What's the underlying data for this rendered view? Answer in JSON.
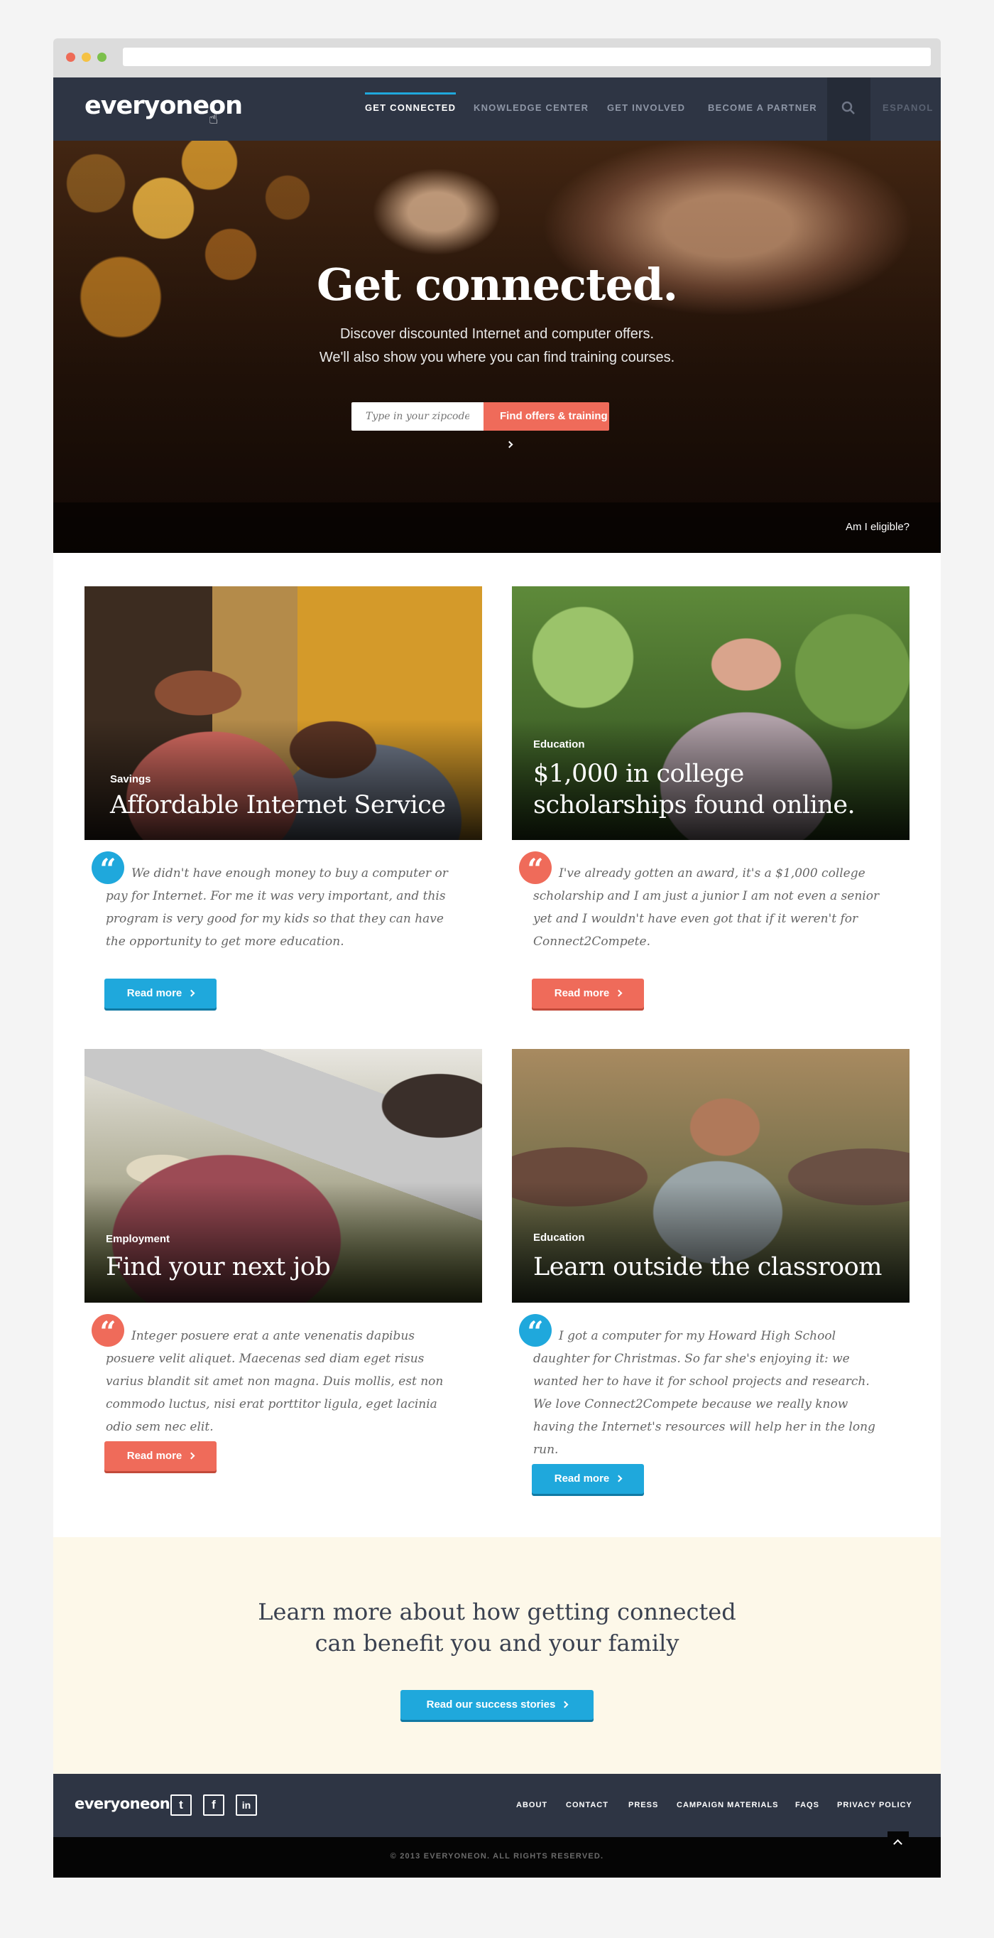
{
  "nav": {
    "logo": "everyoneon",
    "items": [
      {
        "label": "GET CONNECTED",
        "active": true
      },
      {
        "label": "KNOWLEDGE CENTER"
      },
      {
        "label": "GET INVOLVED"
      },
      {
        "label": "BECOME A PARTNER"
      }
    ],
    "lang": "ESPANOL"
  },
  "hero": {
    "title": "Get connected.",
    "sub1": "Discover discounted Internet and computer offers.",
    "sub2": "We'll also show you where you can find training courses.",
    "zip_placeholder": "Type in your zipcode",
    "button": "Find offers & training",
    "eligible": "Am I eligible?"
  },
  "cards": [
    {
      "category": "Savings",
      "title": "Affordable Internet Service",
      "quote": "We didn't have enough money to buy a computer or pay for Internet. For me it was very important, and this program is very good for my kids so that they can have the opportunity to get more education.",
      "button": "Read more",
      "accent": "blue"
    },
    {
      "category": "Education",
      "title": "$1,000 in college scholarships found online.",
      "quote": "I've already gotten an award, it's a $1,000 college scholarship and I am just a junior I am not even a senior yet and I wouldn't have even got that if it weren't for Connect2Compete.",
      "button": "Read more",
      "accent": "red"
    },
    {
      "category": "Employment",
      "title": "Find your next job",
      "quote": "Integer posuere erat a ante venenatis dapibus posuere velit aliquet. Maecenas sed diam eget risus varius blandit sit amet non magna. Duis mollis, est non commodo luctus, nisi erat porttitor ligula, eget lacinia odio sem nec elit.",
      "button": "Read more",
      "accent": "red"
    },
    {
      "category": "Education",
      "title": "Learn outside the classroom",
      "quote": "I got a computer for my Howard High School daughter for Christmas. So far she's enjoying it: we wanted her to have it for school projects and research. We love Connect2Compete because we really know having the Internet's resources will help her in the long run.",
      "button": "Read more",
      "accent": "blue"
    }
  ],
  "cta": {
    "line1": "Learn more about how getting connected",
    "line2": "can benefit you and your family",
    "button": "Read our success stories"
  },
  "footer": {
    "logo": "everyoneon",
    "social": [
      "twitter-icon",
      "facebook-icon",
      "linkedin-icon"
    ],
    "links": [
      "ABOUT",
      "CONTACT",
      "PRESS",
      "CAMPAIGN MATERIALS",
      "FAQS",
      "PRIVACY POLICY"
    ],
    "copyright": "© 2013 EVERYONEON. ALL RIGHTS RESERVED."
  },
  "colors": {
    "nav_bg": "#2e3544",
    "accent_blue": "#1fa8dc",
    "accent_red": "#ef6b5a",
    "cta_bg": "#fdf8e9"
  }
}
